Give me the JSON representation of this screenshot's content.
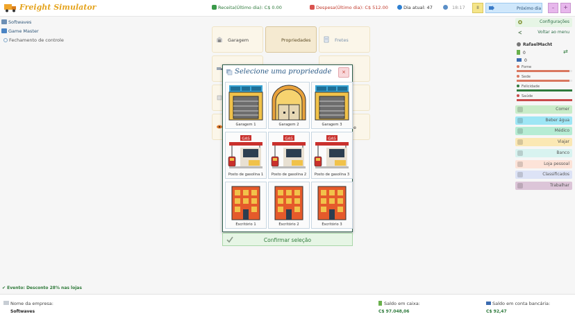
{
  "app": {
    "title": "Freight Simulator"
  },
  "header": {
    "receita": "Receita(Último dia): C$ 0.00",
    "despesa": "Despesa(Último dia): C$ 512.00",
    "dia": "Dia atual: 47",
    "hora": "18:17",
    "pause_label": "II",
    "next_day_label": "Próximo dia",
    "min_label": "–",
    "max_label": "+"
  },
  "sidebar": {
    "items": [
      {
        "label": "Softwaves"
      },
      {
        "label": "Game Master"
      },
      {
        "label": "Fechamento de controle"
      }
    ]
  },
  "tiles": {
    "garagem": "Garagem",
    "propriedades": "Propriedades",
    "fretes": "Fretes",
    "partial_letter": "e"
  },
  "modal": {
    "title": "Selecione uma propriedade",
    "close_label": "×",
    "confirm_label": "Confirmar seleção",
    "properties": [
      {
        "label": "Garagem 1",
        "kind": "garage"
      },
      {
        "label": "Garagem 2",
        "kind": "warehouse"
      },
      {
        "label": "Garagem 3",
        "kind": "garage"
      },
      {
        "label": "Posto de gasolina 1",
        "kind": "gas",
        "sign": "GAS"
      },
      {
        "label": "Posto de gasolina 2",
        "kind": "gas",
        "sign": "GAS"
      },
      {
        "label": "Posto de gasolina 3",
        "kind": "gas",
        "sign": "GAS"
      },
      {
        "label": "Escritório 1",
        "kind": "office"
      },
      {
        "label": "Escritório 2",
        "kind": "office"
      },
      {
        "label": "Escritório 3",
        "kind": "office"
      }
    ]
  },
  "right_panel": {
    "config": "Configurações",
    "back_menu": "Voltar ao menu",
    "player": "RafaelMacht",
    "money_count": "0",
    "bank_count": "0",
    "needs": [
      {
        "label": "Fome",
        "color": "#d9775f",
        "value": 0.95
      },
      {
        "label": "Sede",
        "color": "#d9775f",
        "value": 0.95
      },
      {
        "label": "Felicidade",
        "color": "#2e7a3c",
        "value": 1.0
      },
      {
        "label": "Saúde",
        "color": "#c94b4b",
        "value": 1.0
      }
    ],
    "actions": [
      {
        "label": "Comer",
        "color": "#c9ecc9"
      },
      {
        "label": "Beber água",
        "color": "#9ee6f5"
      },
      {
        "label": "Médico",
        "color": "#b6ecd4"
      },
      {
        "label": "Viajar",
        "color": "#fbe8b4"
      },
      {
        "label": "Banco",
        "color": "#d8f3f0"
      },
      {
        "label": "Loja pessoal",
        "color": "#fde3d8"
      },
      {
        "label": "Classificados",
        "color": "#dde3f6"
      },
      {
        "label": "Trabalhar",
        "color": "#dcc5d8"
      }
    ]
  },
  "event": "Evento: Desconto 28% nas lojas",
  "footer": {
    "company_label": "Nome da empresa:",
    "company_value": "Softwaves",
    "cash_label": "Saldo em caixa:",
    "cash_value": "C$  97.048,06",
    "bank_label": "Saldo em conta bancária:",
    "bank_value": "C$  92,47"
  }
}
